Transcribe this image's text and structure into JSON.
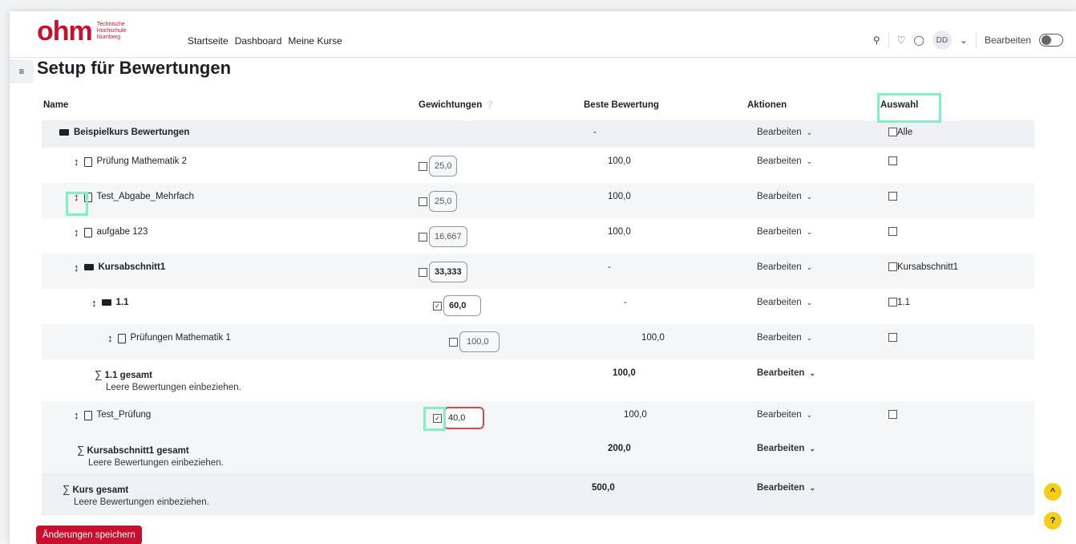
{
  "logo": {
    "text": "ohm",
    "sub": "Technische Hochschule Nürnberg"
  },
  "nav": {
    "home": "Startseite",
    "dashboard": "Dashboard",
    "courses": "Meine Kurse"
  },
  "user": {
    "initials": "DD",
    "edit_label": "Bearbeiten"
  },
  "page": {
    "title": "Setup für Bewertungen"
  },
  "headers": {
    "name": "Name",
    "weights": "Gewichtungen",
    "best": "Beste Bewertung",
    "actions": "Aktionen",
    "select": "Auswahl"
  },
  "rows": [
    {
      "name": "Beispielkurs Bewertungen",
      "best": "-",
      "action": "Bearbeiten",
      "select": "Alle"
    },
    {
      "name": "Prüfung Mathematik 2",
      "weight": "25,0",
      "best": "100,0",
      "action": "Bearbeiten"
    },
    {
      "name": "Test_Abgabe_Mehrfach",
      "weight": "25,0",
      "best": "100,0",
      "action": "Bearbeiten"
    },
    {
      "name": "aufgabe 123",
      "weight": "16,667",
      "best": "100,0",
      "action": "Bearbeiten"
    },
    {
      "name": "Kursabschnitt1",
      "weight": "33,333",
      "best": "-",
      "action": "Bearbeiten",
      "select": "Kursabschnitt1"
    },
    {
      "name": "1.1",
      "weight": "60,0",
      "best": "-",
      "action": "Bearbeiten",
      "select": "1.1"
    },
    {
      "name": "Prüfungen Mathematik 1",
      "weight": "100,0",
      "best": "100,0",
      "action": "Bearbeiten"
    },
    {
      "name": "1.1 gesamt",
      "sub": "Leere Bewertungen einbeziehen.",
      "best": "100,0",
      "action": "Bearbeiten"
    },
    {
      "name": "Test_Prüfung",
      "weight": "40,0",
      "best": "100,0",
      "action": "Bearbeiten"
    },
    {
      "name": "Kursabschnitt1 gesamt",
      "sub": "Leere Bewertungen einbeziehen.",
      "best": "200,0",
      "action": "Bearbeiten"
    },
    {
      "name": "Kurs gesamt",
      "sub": "Leere Bewertungen einbeziehen.",
      "best": "500,0",
      "action": "Bearbeiten"
    }
  ],
  "save_label": "Änderungen speichern",
  "fab": {
    "up": "^",
    "help": "?"
  }
}
